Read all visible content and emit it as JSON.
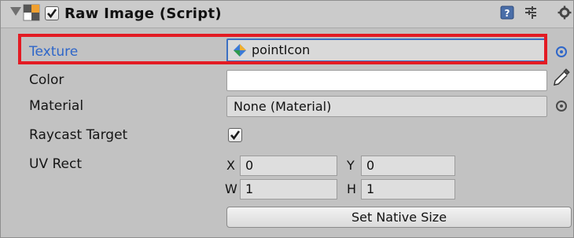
{
  "component": {
    "title": "Raw Image (Script)",
    "enabled": true,
    "header_icons": [
      "help-icon",
      "presets-icon",
      "settings-gear-icon"
    ]
  },
  "properties": {
    "texture": {
      "label": "Texture",
      "value": "pointIcon"
    },
    "color": {
      "label": "Color",
      "value": "#ffffff"
    },
    "material": {
      "label": "Material",
      "value": "None (Material)"
    },
    "raycast": {
      "label": "Raycast Target",
      "checked": true
    },
    "uv_rect": {
      "label": "UV Rect",
      "x_label": "X",
      "x": "0",
      "y_label": "Y",
      "y": "0",
      "w_label": "W",
      "w": "1",
      "h_label": "H",
      "h": "1"
    }
  },
  "set_native_size_label": "Set Native Size",
  "colors": {
    "highlight": "#e31b23",
    "selected_text": "#2e66c9",
    "panel": "#c2c2c2"
  }
}
